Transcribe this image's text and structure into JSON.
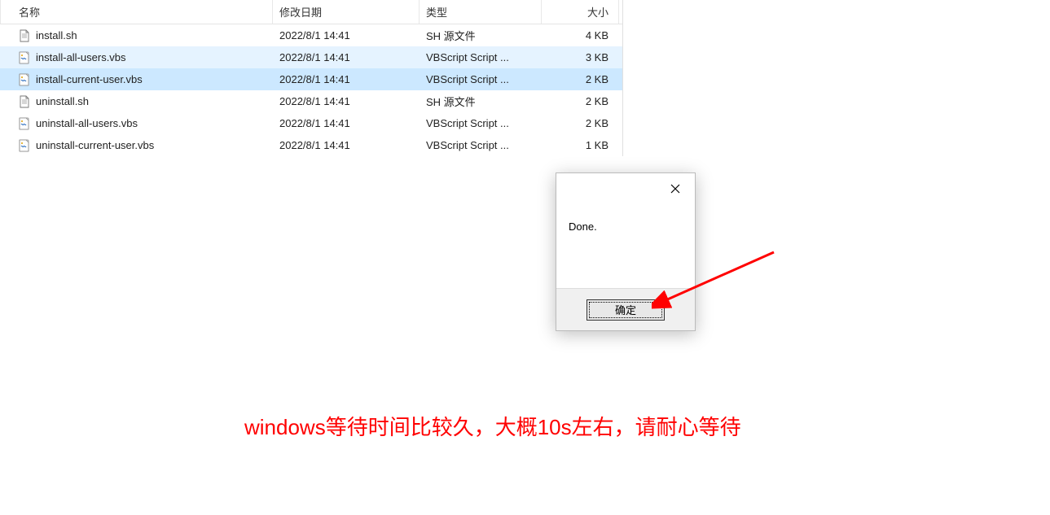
{
  "columns": {
    "name": "名称",
    "date": "修改日期",
    "type": "类型",
    "size": "大小"
  },
  "files": [
    {
      "name": "install.sh",
      "date": "2022/8/1 14:41",
      "type": "SH 源文件",
      "size": "4 KB",
      "icon": "sh",
      "state": ""
    },
    {
      "name": "install-all-users.vbs",
      "date": "2022/8/1 14:41",
      "type": "VBScript Script ...",
      "size": "3 KB",
      "icon": "vbs",
      "state": "hover"
    },
    {
      "name": "install-current-user.vbs",
      "date": "2022/8/1 14:41",
      "type": "VBScript Script ...",
      "size": "2 KB",
      "icon": "vbs",
      "state": "selected"
    },
    {
      "name": "uninstall.sh",
      "date": "2022/8/1 14:41",
      "type": "SH 源文件",
      "size": "2 KB",
      "icon": "sh",
      "state": ""
    },
    {
      "name": "uninstall-all-users.vbs",
      "date": "2022/8/1 14:41",
      "type": "VBScript Script ...",
      "size": "2 KB",
      "icon": "vbs",
      "state": ""
    },
    {
      "name": "uninstall-current-user.vbs",
      "date": "2022/8/1 14:41",
      "type": "VBScript Script ...",
      "size": "1 KB",
      "icon": "vbs",
      "state": ""
    }
  ],
  "dialog": {
    "message": "Done.",
    "ok_label": "确定"
  },
  "annotation": {
    "text": "windows等待时间比较久，大概10s左右，请耐心等待"
  }
}
